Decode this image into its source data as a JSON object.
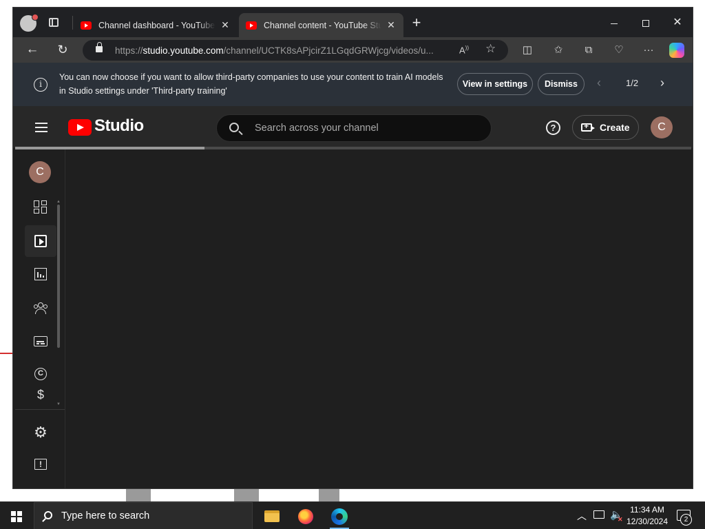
{
  "browser": {
    "tabs": [
      {
        "title": "Channel dashboard - YouTube Studio",
        "active": false
      },
      {
        "title": "Channel content - YouTube Studio",
        "active": true
      }
    ],
    "url_prefix": "https://",
    "url_host": "studio.youtube.com",
    "url_path": "/channel/UCTK8sAPjcirZ1LGqdGRWjcg/videos/u...",
    "icons": {
      "reader": "read-aloud-icon",
      "favorite": "star-icon",
      "toolbar": [
        "split-screen-icon",
        "favorites-icon",
        "collections-icon",
        "browser-essentials-icon",
        "more-icon",
        "copilot-icon"
      ]
    }
  },
  "banner": {
    "message": "You can now choose if you want to allow third-party companies to use your content to train AI models in Studio settings under 'Third-party training'",
    "view_label": "View in settings",
    "dismiss_label": "Dismiss",
    "pager": "1/2"
  },
  "studio": {
    "brand": "Studio",
    "search_placeholder": "Search across your channel",
    "create_label": "Create",
    "avatar_initial": "C",
    "progress": 0.28,
    "sidebar": [
      {
        "name": "dashboard",
        "icon": "dashboard-icon",
        "selected": false
      },
      {
        "name": "content",
        "icon": "content-icon",
        "selected": true
      },
      {
        "name": "analytics",
        "icon": "analytics-icon",
        "selected": false
      },
      {
        "name": "community",
        "icon": "community-icon",
        "selected": false
      },
      {
        "name": "subtitles",
        "icon": "subtitles-icon",
        "selected": false
      },
      {
        "name": "copyright",
        "icon": "copyright-icon",
        "selected": false
      },
      {
        "name": "earn",
        "icon": "earn-icon",
        "selected": false
      }
    ],
    "sidebar_bottom": [
      {
        "name": "settings",
        "icon": "gear-icon"
      },
      {
        "name": "send-feedback",
        "icon": "feedback-icon"
      }
    ],
    "colors": {
      "accent": "#ff0000",
      "background": "#1f1f1f",
      "topbar": "#282828",
      "banner": "#2b3139"
    }
  },
  "taskbar": {
    "search_text": "Type here to search",
    "apps": [
      "file-explorer-icon",
      "firefox-icon",
      "edge-icon"
    ],
    "time": "11:34 AM",
    "date": "12/30/2024",
    "notifications": "2"
  }
}
